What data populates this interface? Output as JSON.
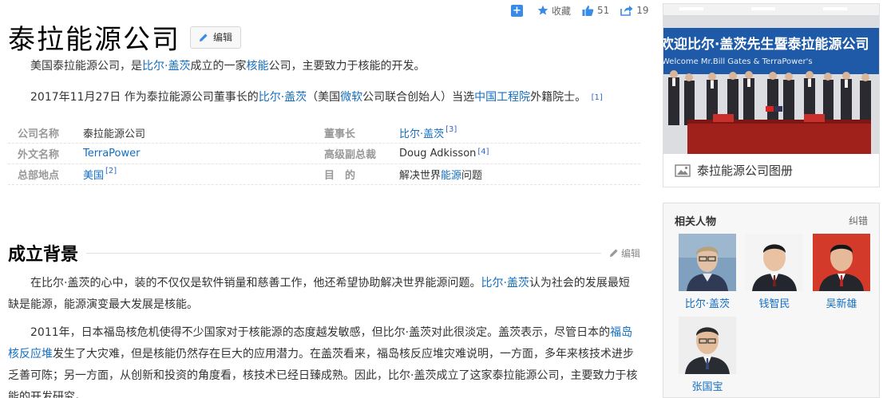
{
  "actions": {
    "favorite_label": "收藏",
    "like_count": "51",
    "share_count": "19"
  },
  "title": "泰拉能源公司",
  "edit_label": "编辑",
  "intro": {
    "p1": {
      "t1": "美国泰拉能源公司，是",
      "link1": "比尔·盖茨",
      "t2": "成立的一家",
      "link2": "核能",
      "t3": "公司，主要致力于核能的开发。"
    },
    "p2": {
      "t1": "2017年11月27日 作为泰拉能源公司董事长的",
      "link1": "比尔·盖茨",
      "t2": "（美国",
      "link2": "微软",
      "t3": "公司联合创始人）当选",
      "link3": "中国工程院",
      "t4": "外籍院士。",
      "ref": "[1]"
    }
  },
  "info": {
    "rows": [
      {
        "k": "公司名称",
        "v": "泰拉能源公司",
        "k2": "董事长",
        "v2": "比尔·盖茨",
        "ref2": "[3]"
      },
      {
        "k": "外文名称",
        "v": "TerraPower",
        "k2": "高级副总裁",
        "v2": "Doug Adkisson",
        "ref2": "[4]"
      },
      {
        "k": "总部地点",
        "v": "美国",
        "ref": "[2]",
        "k2": "目　的",
        "v2a": "解决世界",
        "v2link": "能源",
        "v2b": "问题"
      }
    ]
  },
  "section": {
    "title": "成立背景",
    "edit_label": "编辑",
    "p1": {
      "t1": "在比尔·盖茨的心中，装的不仅仅是软件销量和慈善工作，他还希望协助解决世界能源问题。",
      "link1": "比尔·盖茨",
      "t2": "认为社会的发展最短缺是能源，能源演变最大发展是核能。"
    },
    "p2": {
      "t1": "2011年，日本福岛核危机使得不少国家对于核能源的态度越发敏感，但比尔·盖茨对此很淡定。盖茨表示，尽管日本的",
      "link1": "福岛核反应堆",
      "t2": "发生了大灾难，但是核能仍然存在巨大的应用潜力。在盖茨看来，福岛核反应堆灾难说明，一方面，多年来核技术进步乏善可陈；另一方面，从创新和投资的角度看，核技术已经日臻成熟。因此，比尔·盖茨成立了这家泰拉能源公司，主要致力于核能的开发研究。"
    }
  },
  "album": {
    "banner_text": "欢迎比尔·盖茨先生暨泰拉能源公司",
    "banner_sub": "Welcome Mr.Bill Gates & TerraPower's",
    "caption": "泰拉能源公司图册"
  },
  "related": {
    "title": "相关人物",
    "fix_label": "纠错",
    "people": [
      {
        "name": "比尔·盖茨"
      },
      {
        "name": "钱智民"
      },
      {
        "name": "吴新雄"
      },
      {
        "name": "张国宝"
      }
    ]
  },
  "colors": {
    "link": "#136ec2",
    "banner_blue": "#1f5aa8",
    "table_red": "#a0201c"
  }
}
